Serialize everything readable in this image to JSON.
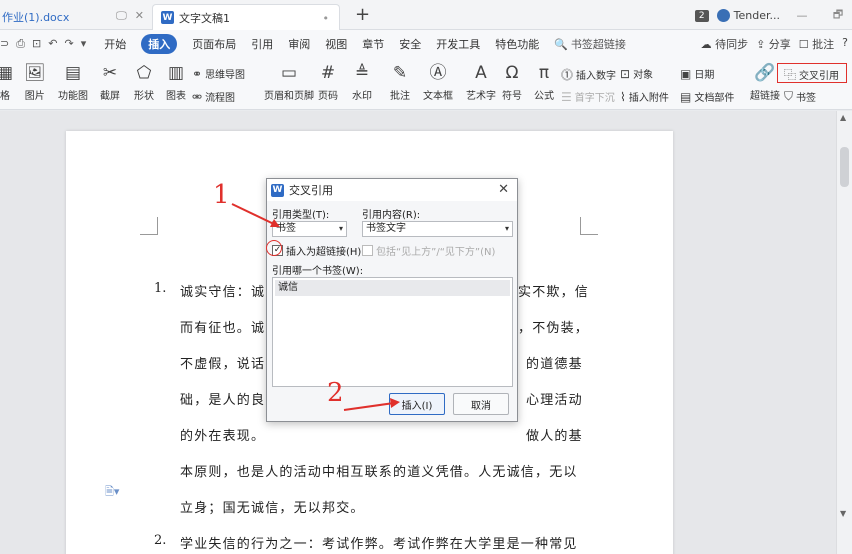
{
  "titlebar": {
    "doc_tab": "作业(1).docx",
    "active_tab": "文字文稿1",
    "tab_dot": "•",
    "plus": "+",
    "window_count": "2",
    "user_name": "Tender...",
    "minimize": "—",
    "restore": "🗗"
  },
  "menubar": {
    "items": [
      "开始",
      "插入",
      "页面布局",
      "引用",
      "审阅",
      "视图",
      "章节",
      "安全",
      "开发工具",
      "特色功能"
    ],
    "active": "插入",
    "search": "书签超链接",
    "sync": "待同步",
    "share": "分享",
    "comment": "批注",
    "help": "?"
  },
  "ribbon": {
    "table": "格",
    "picture": "图片",
    "func_graph": "功能图",
    "screenshot": "截屏",
    "shape": "形状",
    "chart": "图表",
    "mindmap": "思维导图",
    "flowchart": "流程图",
    "header_footer": "页眉和页脚",
    "page_num": "页码",
    "watermark": "水印",
    "annotation": "批注",
    "textbox": "文本框",
    "wordart": "艺术字",
    "symbol": "符号",
    "formula": "公式",
    "insert_number": "插入数字",
    "object": "对象",
    "date": "日期",
    "dropcap": "首字下沉",
    "attachment": "插入附件",
    "doc_parts": "文档部件",
    "hyperlink": "超链接",
    "cross_ref": "交叉引用",
    "bookmark": "书签"
  },
  "document": {
    "num1": "1.",
    "num2": "2.",
    "lines": [
      "诚实守信：诚",
      "而有征也。诚",
      "不虚假，说话",
      "础，是人的良",
      "的外在表现。",
      "本原则，也是人的活动中相互联系的道义凭借。人无诚信，无以",
      "立身；国无诚信，无以邦交。",
      "学业失信的行为之一：考试作弊。考试作弊在大学里是一种常见"
    ],
    "right_frags": [
      "实不欺，信",
      "，不伪装，",
      "的道德基",
      "心理活动",
      "做人的基"
    ]
  },
  "dialog": {
    "title": "交叉引用",
    "close": "✕",
    "ref_type_label": "引用类型(T):",
    "ref_type_value": "书签",
    "ref_content_label": "引用内容(R):",
    "ref_content_value": "书签文字",
    "hyperlink_check": "插入为超链接(H)",
    "include_check": "包括“见上方”/“见下方”(N)",
    "list_label": "引用哪一个书签(W):",
    "list_items": [
      "诚信"
    ],
    "insert_button": "插入(I)",
    "cancel_button": "取消"
  },
  "annotations": {
    "num1": "1",
    "num2": "2"
  },
  "colors": {
    "accent": "#2f6bc4",
    "annotation_red": "#e0302c"
  }
}
